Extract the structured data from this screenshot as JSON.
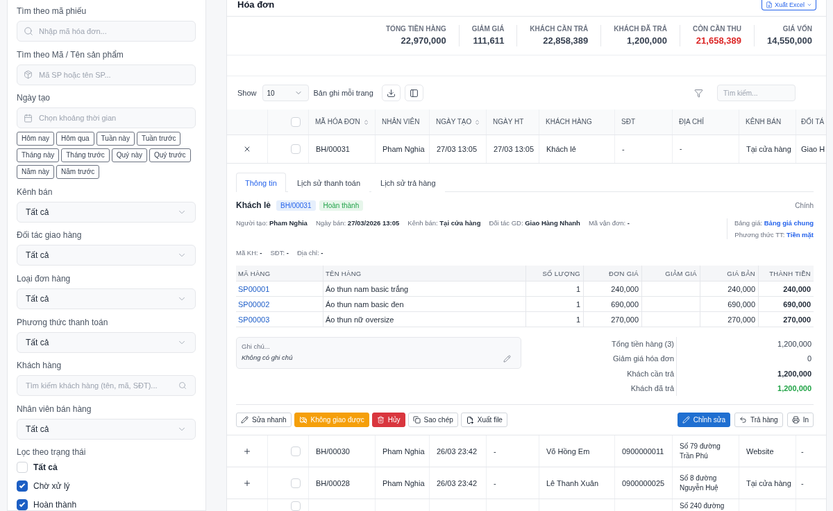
{
  "header": {
    "title": "Hóa đơn",
    "export_button": "Xuất Excel"
  },
  "summary": [
    {
      "label": "TỔNG TIỀN HÀNG",
      "value": "22,970,000",
      "highlight": false
    },
    {
      "label": "GIẢM GIÁ",
      "value": "111,611",
      "highlight": false
    },
    {
      "label": "KHÁCH CẦN TRẢ",
      "value": "22,858,389",
      "highlight": false
    },
    {
      "label": "KHÁCH ĐÃ TRẢ",
      "value": "1,200,000",
      "highlight": false
    },
    {
      "label": "CÒN CẦN THU",
      "value": "21,658,389",
      "highlight": true
    },
    {
      "label": "GIÁ VỐN",
      "value": "14,550,000",
      "highlight": false
    }
  ],
  "toolbar": {
    "show_label": "Show",
    "page_size": "10",
    "per_page_label": "Bản ghi mỗi trang",
    "search_placeholder": "Tìm kiếm..."
  },
  "table": {
    "select_all_checked": false,
    "columns": [
      {
        "label": "MÃ HÓA ĐƠN",
        "sortable": true
      },
      {
        "label": "NHÂN VIÊN",
        "sortable": false
      },
      {
        "label": "NGÀY TẠO",
        "sortable": true
      },
      {
        "label": "NGÀY HT",
        "sortable": false
      },
      {
        "label": "KHÁCH HÀNG",
        "sortable": false
      },
      {
        "label": "SĐT",
        "sortable": false
      },
      {
        "label": "ĐỊA CHỈ",
        "sortable": false
      },
      {
        "label": "KÊNH BÁN",
        "sortable": false
      },
      {
        "label": "ĐỐI TÁ"
      }
    ],
    "rows": [
      {
        "expanded": true,
        "checked": false,
        "cells": [
          "BH/00031",
          "Pham Nghia",
          "27/03 13:05",
          "27/03 13:05",
          "Khách lẻ",
          "-",
          "-",
          "Tại cửa hàng",
          "Giao H"
        ],
        "detail": {
          "tabs": [
            {
              "label": "Thông tin",
              "selected": true
            },
            {
              "label": "Lịch sử thanh toán",
              "selected": false
            },
            {
              "label": "Lịch sử trả hàng",
              "selected": false
            }
          ],
          "customer": "Khách lẻ",
          "badges": [
            {
              "text": "BH/00031",
              "kind": "code"
            },
            {
              "text": "Hoàn thành",
              "kind": "status"
            }
          ],
          "branch": "Chính",
          "info": [
            {
              "label": "Người tạo:",
              "value": "Pham Nghia"
            },
            {
              "label": "Ngày bán:",
              "value": "27/03/2026 13:05"
            },
            {
              "label": "Kênh bán:",
              "value": "Tại cửa hàng"
            },
            {
              "label": "Đối tác GD:",
              "value": "Giao Hàng Nhanh"
            },
            {
              "label": "Mã vận đơn:",
              "value": "-"
            }
          ],
          "pricing": [
            {
              "label": "Bảng giá:",
              "value": "Bảng giá chung"
            },
            {
              "label": "Phương thức TT:",
              "value": "Tiền mặt"
            }
          ],
          "contact": [
            {
              "label": "Mã KH:",
              "value": "-"
            },
            {
              "label": "SĐT:",
              "value": "-"
            },
            {
              "label": "Địa chỉ:",
              "value": "-"
            }
          ],
          "items": {
            "columns": [
              "MÃ HÀNG",
              "TÊN HÀNG",
              "SỐ LƯỢNG",
              "ĐƠN GIÁ",
              "GIẢM GIÁ",
              "GIÁ BẢN",
              "THÀNH TIỀN"
            ],
            "rows": [
              {
                "code": "SP00001",
                "name": "Áo thun nam basic trắng",
                "quantity": "1",
                "unit_price": "240,000",
                "sale_price": "240,000",
                "total": "240,000"
              },
              {
                "code": "SP00002",
                "name": "Áo thun nam basic đen",
                "quantity": "1",
                "unit_price": "690,000",
                "sale_price": "690,000",
                "total": "690,000"
              },
              {
                "code": "SP00003",
                "name": "Áo thun nữ oversize",
                "quantity": "1",
                "unit_price": "270,000",
                "sale_price": "270,000",
                "total": "270,000"
              }
            ]
          },
          "note": {
            "label": "Ghi chú...",
            "text": "Không có ghi chú"
          },
          "totals": [
            {
              "label": "Tổng tiền hàng (3)",
              "value": "1,200,000",
              "kind": "normal"
            },
            {
              "label": "Giảm giá hóa đơn",
              "value": "0",
              "kind": "normal"
            },
            {
              "label": "Khách cần trả",
              "value": "1,200,000",
              "kind": "strong"
            },
            {
              "label": "Khách đã trả",
              "value": "1,200,000",
              "kind": "paid"
            }
          ],
          "actions_left": [
            {
              "label": "Sửa nhanh",
              "kind": "quickedit"
            },
            {
              "label": "Không giao được",
              "kind": "undeliverable"
            },
            {
              "label": "Hủy",
              "kind": "cancel"
            },
            {
              "label": "Sao chép",
              "kind": "copy"
            },
            {
              "label": "Xuất file",
              "kind": "export"
            }
          ],
          "actions_right": [
            {
              "label": "Chỉnh sửa",
              "kind": "edit"
            },
            {
              "label": "Trả hàng",
              "kind": "return"
            },
            {
              "label": "In",
              "kind": "print"
            }
          ]
        }
      },
      {
        "expanded": false,
        "checked": false,
        "cells": [
          "BH/00030",
          "Pham Nghia",
          "26/03 23:42",
          "-",
          "Võ Hồng Em",
          "0900000011",
          "Số 79 đường Trần Phú",
          "Website",
          "-"
        ]
      },
      {
        "expanded": false,
        "checked": false,
        "cells": [
          "BH/00028",
          "Pham Nghia",
          "26/03 23:42",
          "-",
          "Lê Thanh Xuân",
          "0900000025",
          "Số 8 đường Nguyễn Huệ",
          "Tại cửa hàng",
          "-"
        ]
      },
      {
        "checked": false,
        "address": "Số 240 đường"
      }
    ]
  },
  "sidebar": {
    "fields": [
      {
        "kind": "invoice",
        "label": "Tìm theo mã phiếu",
        "placeholder": "Nhập mã hóa đơn..."
      },
      {
        "kind": "product",
        "label": "Tìm theo Mã / Tên sản phẩm",
        "placeholder": "Mã SP hoặc tên SP..."
      },
      {
        "kind": "date",
        "label": "Ngày tạo",
        "placeholder": "Chọn khoảng thời gian",
        "presets": [
          {
            "label": "Hôm nay",
            "selected": false
          },
          {
            "label": "Hôm qua",
            "selected": false
          },
          {
            "label": "Tuần này",
            "selected": false
          },
          {
            "label": "Tuần trước",
            "selected": false
          },
          {
            "label": "Tháng này",
            "selected": false
          },
          {
            "label": "Tháng trước",
            "selected": false
          },
          {
            "label": "Quý này",
            "selected": false
          },
          {
            "label": "Quý trước",
            "selected": false
          },
          {
            "label": "Năm này",
            "selected": false
          },
          {
            "label": "Năm trước",
            "selected": false
          }
        ]
      },
      {
        "kind": "select",
        "label": "Kênh bán",
        "value": "Tất cả"
      },
      {
        "kind": "select",
        "label": "Đối tác giao hàng",
        "value": "Tất cả"
      },
      {
        "kind": "select",
        "label": "Loại đơn hàng",
        "value": "Tất cả"
      },
      {
        "kind": "select",
        "label": "Phương thức thanh toán",
        "value": "Tất cả"
      },
      {
        "kind": "customer",
        "label": "Khách hàng",
        "placeholder": "Tìm kiếm khách hàng (tên, mã, SĐT)..."
      },
      {
        "kind": "select",
        "label": "Nhân viên bán hàng",
        "value": "Tất cả"
      }
    ],
    "status_filter": {
      "label": "Lọc theo trạng thái",
      "options": [
        {
          "label": "Tất cả",
          "checked": false,
          "kind": "all"
        },
        {
          "label": "Chờ xử lý",
          "checked": true,
          "kind": "status"
        },
        {
          "label": "Hoàn thành",
          "checked": true,
          "kind": "status"
        }
      ]
    }
  }
}
